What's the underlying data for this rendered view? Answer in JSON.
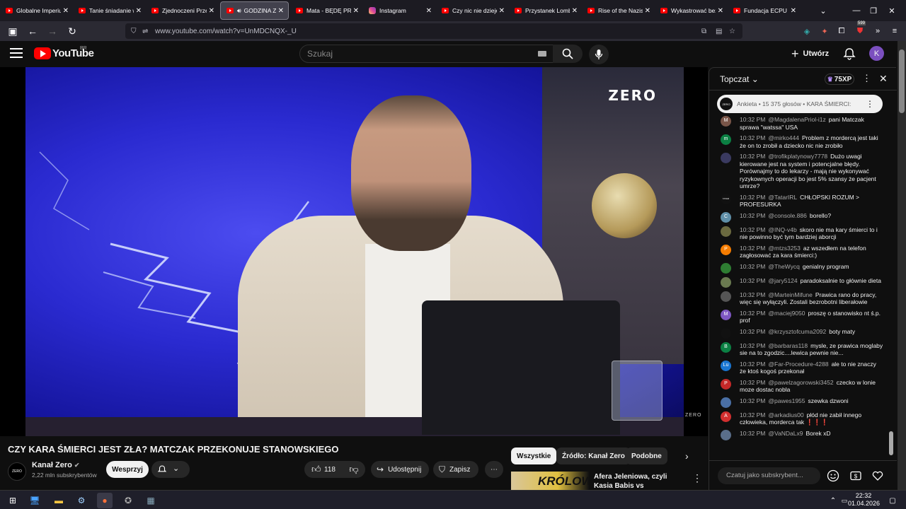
{
  "browser": {
    "tabs": [
      {
        "title": "Globalne Imperium",
        "icon": "youtube-icon"
      },
      {
        "title": "Tanie śniadanie w",
        "icon": "youtube-icon"
      },
      {
        "title": "Zjednoczeni Przec",
        "icon": "youtube-icon"
      },
      {
        "title": "GODZINA ZER",
        "icon": "youtube-icon",
        "active": true,
        "audio": true
      },
      {
        "title": "Mata - BĘDĘ PREZ",
        "icon": "youtube-icon"
      },
      {
        "title": "Instagram",
        "icon": "instagram-icon"
      },
      {
        "title": "Czy nic nie dzieje",
        "icon": "youtube-icon"
      },
      {
        "title": "Przystanek Lomba",
        "icon": "youtube-icon"
      },
      {
        "title": "Rise of the Nazis",
        "icon": "youtube-icon"
      },
      {
        "title": "Wykastrować bez",
        "icon": "youtube-icon"
      },
      {
        "title": "Fundacja ECPU Po",
        "icon": "youtube-icon"
      }
    ],
    "url": "www.youtube.com/watch?v=UnMDCNQX-_U",
    "ext_badge": "599"
  },
  "youtube": {
    "logo_text": "YouTube",
    "country_code": "BR",
    "search_placeholder": "Szukaj",
    "create_label": "Utwórz",
    "avatar_letter": "K"
  },
  "video": {
    "overlay_logo": "ZERO",
    "overlay_logo_small": "ZERO",
    "title": "CZY KARA ŚMIERCI JEST ZŁA? MATCZAK PRZEKONUJE STANOWSKIEGO",
    "channel": "Kanał Zero",
    "channel_avatar_text": "ZERO",
    "subscribers": "2,22 mln subskrybentów",
    "subscribe_label": "Wesprzyj",
    "likes": "118",
    "share_label": "Udostępnij",
    "save_label": "Zapisz"
  },
  "recommendations": {
    "chips": [
      "Wszystkie",
      "Źródło: Kanał Zero",
      "Podobne"
    ],
    "item": {
      "thumb_text": "KRÓLOWA",
      "title": "Afera Jeleniowa, czyli Kasia Babis vs BezSchematu vs ..."
    }
  },
  "chat": {
    "mode": "Topczat",
    "xp": "75XP",
    "poll_avatar_text": "ZERO",
    "poll_text": "Ankieta • 15 375 głosów • KARA ŚMIERCI:",
    "input_placeholder": "Czatuj jako subskrybent...",
    "messages": [
      {
        "time": "10:32 PM",
        "author": "@MagdalenaPriol-i1z",
        "text": "pani Matczak sprawa \"watssa\" USA",
        "avatar": "M",
        "color": "#795548"
      },
      {
        "time": "10:32 PM",
        "author": "@mirko444",
        "text": "Problem z mordercą jest taki że on to zrobił a dziecko nic nie zrobiło",
        "avatar": "m",
        "color": "#0b8043"
      },
      {
        "time": "10:32 PM",
        "author": "@trofikplatynowy7778",
        "text": "Dużo uwagi kierowane jest na system i potencjalne błędy. Porównajmy to do lekarzy - mają nie wykonywać ryzykownych operacji bo jest 5% szansy że pacjent umrze?",
        "avatar": "",
        "color": "#3a3a60"
      },
      {
        "time": "10:32 PM",
        "author": "@TatarIRL",
        "text": "CHŁOPSKI ROZUM > PROFESURKA",
        "avatar": "TATAR",
        "color": "#111111"
      },
      {
        "time": "10:32 PM",
        "author": "@console.886",
        "text": "borello?",
        "avatar": "C",
        "color": "#5f8fa8"
      },
      {
        "time": "10:32 PM",
        "author": "@INQ-v4b",
        "text": "skoro nie ma kary śmierci to i nie powinno być tym bardziej aborcji",
        "avatar": "",
        "color": "#6b6a40"
      },
      {
        "time": "10:32 PM",
        "author": "@mtzs3253",
        "text": "az wszedłem na telefon zagłosować za kara śmierci:)",
        "avatar": "P",
        "color": "#f57c00"
      },
      {
        "time": "10:32 PM",
        "author": "@TheWycq",
        "text": "genialny program",
        "avatar": "",
        "color": "#2e7d32"
      },
      {
        "time": "10:32 PM",
        "author": "@jary5124",
        "text": "paradoksalnie to głównie dieta",
        "avatar": "",
        "color": "#6a7a50"
      },
      {
        "time": "10:32 PM",
        "author": "@MarteinMifune",
        "text": "Prawica rano do pracy, więc się wyłączyli. Zostali bezrobotni liberałowie",
        "avatar": "",
        "color": "#555555"
      },
      {
        "time": "10:32 PM",
        "author": "@maciej9050",
        "text": "proszę o stanowisko nt ś.p. prof",
        "avatar": "M",
        "color": "#7e57c2"
      },
      {
        "time": "10:32 PM",
        "author": "@krzysztofcuma2092",
        "text": "boty maty",
        "avatar": "",
        "color": "#111111"
      },
      {
        "time": "10:32 PM",
        "author": "@barbaras118",
        "text": "mysle, ze prawica moglaby sie na to zgodzic....lewica pewnie nie...",
        "avatar": "B",
        "color": "#0b8043"
      },
      {
        "time": "10:32 PM",
        "author": "@Far-Procedure-4288",
        "text": "ale to nie znaczy że ktoś kogoś przekonał",
        "avatar": "Lu",
        "color": "#1976d2"
      },
      {
        "time": "10:32 PM",
        "author": "@pawelzagorowski3452",
        "text": "czecko w lonie moze dostac nobla",
        "avatar": "P",
        "color": "#c62828"
      },
      {
        "time": "10:32 PM",
        "author": "@pawes1955",
        "text": "szewka dzwoni",
        "avatar": "",
        "color": "#4a6fa5"
      },
      {
        "time": "10:32 PM",
        "author": "@arkadius00",
        "text": "płód nie zabił innego człowieka, morderca tak ❗❗❗",
        "avatar": "A",
        "color": "#d32f2f"
      },
      {
        "time": "10:32 PM",
        "author": "@VaNDaLx9",
        "text": "Borek xD",
        "avatar": "",
        "color": "#5a6e8a"
      }
    ]
  },
  "taskbar": {
    "time": "22:32",
    "date": "01.04.2026"
  },
  "colors": {
    "yt_red": "#ff0000",
    "bg": "#0f0f0f",
    "chip_bg": "#272727"
  }
}
